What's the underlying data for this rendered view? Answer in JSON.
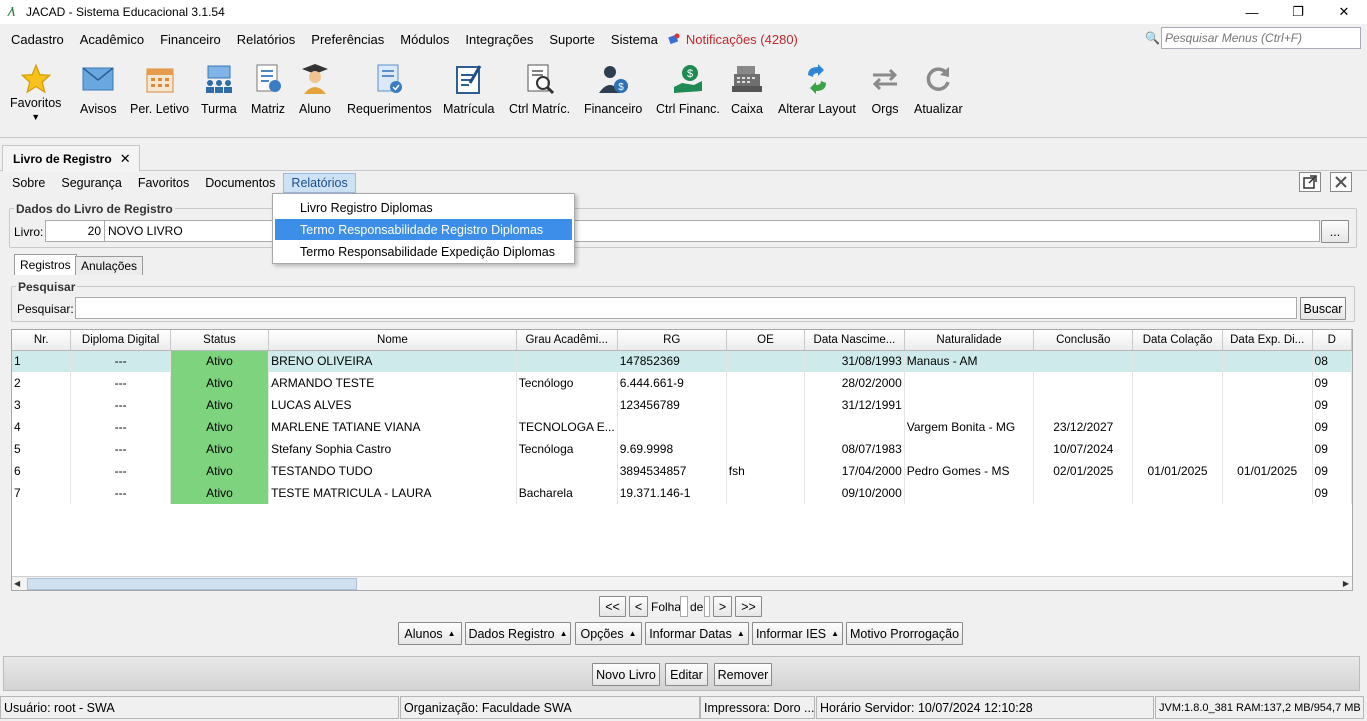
{
  "window": {
    "title": "JACAD - Sistema Educacional 3.1.54",
    "minimize_glyph": "—",
    "restore_glyph": "❐",
    "close_glyph": "✕"
  },
  "menu": {
    "items": [
      "Cadastro",
      "Acadêmico",
      "Financeiro",
      "Relatórios",
      "Preferências",
      "Módulos",
      "Integrações",
      "Suporte",
      "Sistema"
    ],
    "notifications": "Notificações (4280)",
    "search_placeholder": "Pesquisar Menus (Ctrl+F)"
  },
  "toolbar": [
    {
      "label": "Favoritos",
      "icon": "star-icon"
    },
    {
      "label": "Avisos",
      "icon": "envelope-icon"
    },
    {
      "label": "Per. Letivo",
      "icon": "calendar-icon"
    },
    {
      "label": "Turma",
      "icon": "class-group-icon"
    },
    {
      "label": "Matriz",
      "icon": "matrix-icon"
    },
    {
      "label": "Aluno",
      "icon": "student-icon"
    },
    {
      "label": "Requerimentos",
      "icon": "request-icon"
    },
    {
      "label": "Matrícula",
      "icon": "enrollment-icon"
    },
    {
      "label": "Ctrl Matríc.",
      "icon": "enrollment-control-icon"
    },
    {
      "label": "Financeiro",
      "icon": "financial-icon"
    },
    {
      "label": "Ctrl Financ.",
      "icon": "financial-control-icon"
    },
    {
      "label": "Caixa",
      "icon": "cash-register-icon"
    },
    {
      "label": "Alterar Layout",
      "icon": "change-layout-icon"
    },
    {
      "label": "Orgs",
      "icon": "orgs-icon"
    },
    {
      "label": "Atualizar",
      "icon": "refresh-icon"
    }
  ],
  "doc_tab": {
    "label": "Livro de Registro",
    "close": "✕"
  },
  "inner_menu": [
    "Sobre",
    "Segurança",
    "Favoritos",
    "Documentos",
    "Relatórios"
  ],
  "dropdown": [
    "Livro Registro Diplomas",
    "Termo Responsabilidade Registro Diplomas",
    "Termo Responsabilidade Expedição Diplomas"
  ],
  "book": {
    "group_title": "Dados do Livro de Registro",
    "label": "Livro:",
    "number": "20",
    "name": "NOVO LIVRO",
    "browse": "..."
  },
  "subtabs": [
    "Registros",
    "Anulações"
  ],
  "search": {
    "group_title": "Pesquisar",
    "label": "Pesquisar:",
    "value": "",
    "button": "Buscar"
  },
  "grid": {
    "columns": [
      "Nr.",
      "Diploma Digital",
      "Status",
      "Nome",
      "Grau Acadêmi...",
      "RG",
      "OE",
      "Data Nascime...",
      "Naturalidade",
      "Conclusão",
      "Data Colação",
      "Data Exp. Di...",
      "D"
    ],
    "rows": [
      [
        "1",
        "---",
        "Ativo",
        "BRENO OLIVEIRA",
        "",
        "147852369",
        "",
        "31/08/1993",
        "Manaus - AM",
        "",
        "",
        "",
        "08"
      ],
      [
        "2",
        "---",
        "Ativo",
        "ARMANDO TESTE",
        "Tecnólogo",
        "6.444.661-9",
        "",
        "28/02/2000",
        "",
        "",
        "",
        "",
        "09"
      ],
      [
        "3",
        "---",
        "Ativo",
        "LUCAS ALVES",
        "",
        "123456789",
        "",
        "31/12/1991",
        "",
        "",
        "",
        "",
        "09"
      ],
      [
        "4",
        "---",
        "Ativo",
        "MARLENE TATIANE VIANA",
        "TECNOLOGA E...",
        "",
        "",
        "",
        "Vargem Bonita - MG",
        "23/12/2027",
        "",
        "",
        "09"
      ],
      [
        "5",
        "---",
        "Ativo",
        "Stefany Sophia Castro",
        "Tecnóloga",
        "9.69.9998",
        "",
        "08/07/1983",
        "",
        "10/07/2024",
        "",
        "",
        "09"
      ],
      [
        "6",
        "---",
        "Ativo",
        "TESTANDO TUDO",
        "",
        "3894534857",
        "fsh",
        "17/04/2000",
        "Pedro Gomes - MS",
        "02/01/2025",
        "01/01/2025",
        "01/01/2025",
        "09"
      ],
      [
        "7",
        "---",
        "Ativo",
        "TESTE MATRICULA - LAURA",
        "Bacharela",
        "19.371.146-1",
        "",
        "09/10/2000",
        "",
        "",
        "",
        "",
        "09"
      ]
    ],
    "selected_row": 0
  },
  "pager": {
    "first": "<<",
    "prev": "<",
    "folha": "Folha",
    "de": "de",
    "next": ">",
    "last": ">>"
  },
  "grid_actions": [
    "Alunos",
    "Dados Registro",
    "Opções",
    "Informar Datas",
    "Informar IES",
    "Motivo Prorrogação"
  ],
  "bottom_actions": [
    "Novo Livro",
    "Editar",
    "Remover"
  ],
  "status": {
    "user": "Usuário: root - SWA",
    "org": "Organização: Faculdade SWA",
    "printer": "Impressora: Doro ...",
    "server_time": "Horário Servidor: 10/07/2024 12:10:28",
    "jvm": "JVM:1.8.0_381  RAM:137,2 MB/954,7 MB"
  },
  "colors": {
    "selection": "#3d8ee8",
    "status_active": "#7ed37e",
    "row_selected": "#cfeaea",
    "notification": "#c0282c"
  }
}
